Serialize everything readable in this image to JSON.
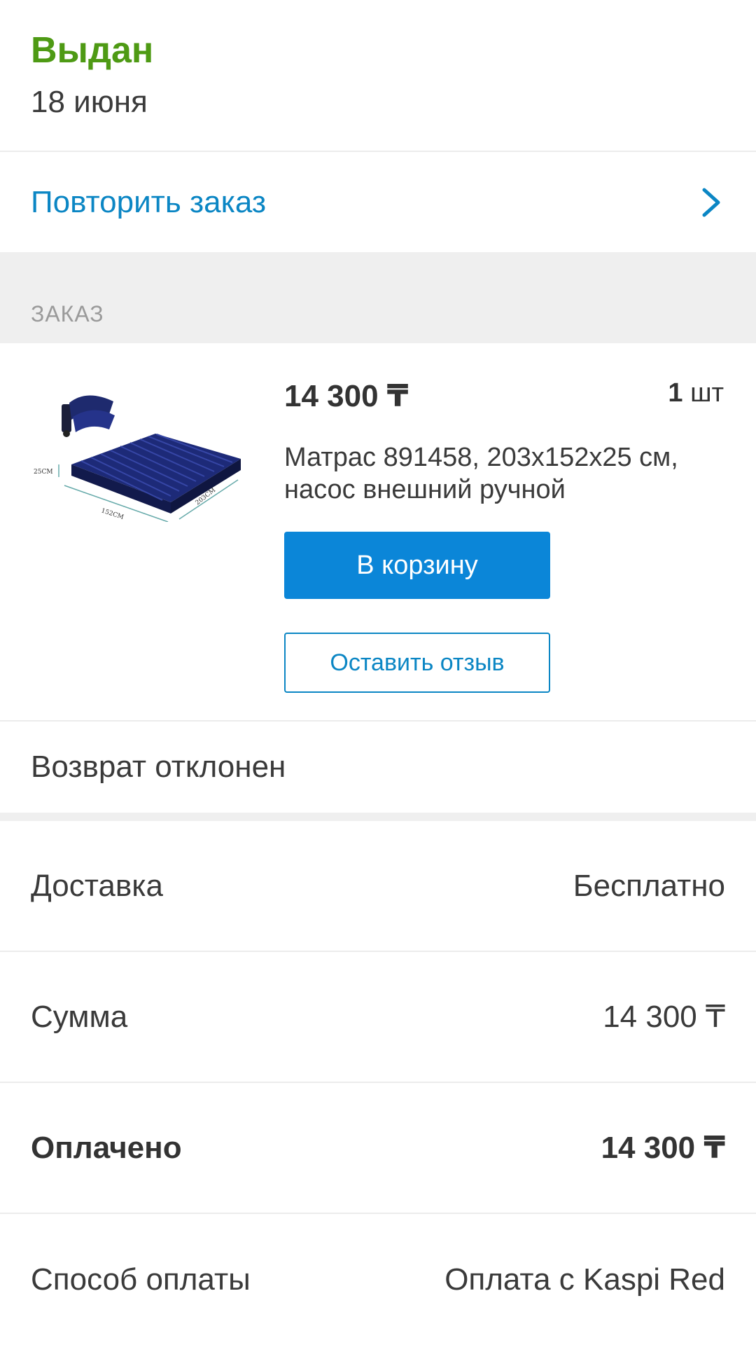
{
  "order_status": {
    "title": "Выдан",
    "date": "18 июня"
  },
  "repeat_order": {
    "label": "Повторить заказ"
  },
  "section": {
    "label": "ЗАКАЗ"
  },
  "product": {
    "price": "14 300 ₸",
    "qty_number": "1",
    "qty_unit": " шт",
    "name": "Матрас 891458, 203x152x25 см, насос внешний ручной",
    "cart_button": "В корзину",
    "review_button": "Оставить отзыв",
    "image_labels": {
      "height": "25CM",
      "width": "152CM",
      "length": "203CM"
    }
  },
  "return_status": "Возврат отклонен",
  "summary": [
    {
      "label": "Доставка",
      "value": "Бесплатно"
    },
    {
      "label": "Сумма",
      "value": "14 300 ₸"
    },
    {
      "label": "Оплачено",
      "value": "14 300 ₸"
    },
    {
      "label": "Способ оплаты",
      "value": "Оплата с Kaspi Red"
    }
  ],
  "colors": {
    "status_green": "#4e9a14",
    "link_blue": "#0b86c4",
    "button_blue": "#0b86d8"
  }
}
